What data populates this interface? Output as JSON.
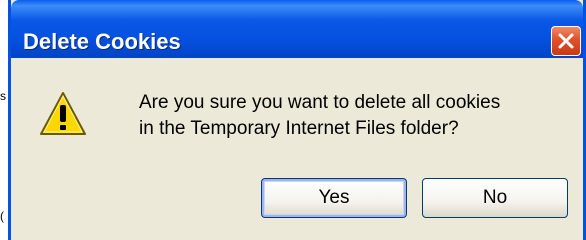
{
  "dialog": {
    "title": "Delete Cookies",
    "message_line1": "Are you sure you want to delete all cookies",
    "message_line2": "in the Temporary Internet Files folder?",
    "icon": "warning-icon",
    "buttons": {
      "yes_label": "Yes",
      "no_label": "No"
    }
  },
  "background_fragments": {
    "top": "s",
    "bottom": "("
  },
  "colors": {
    "titlebar": "#0a58e6",
    "dialog_bg": "#ece9d8",
    "close_button": "#e0512a",
    "warning_yellow": "#ffd700"
  }
}
